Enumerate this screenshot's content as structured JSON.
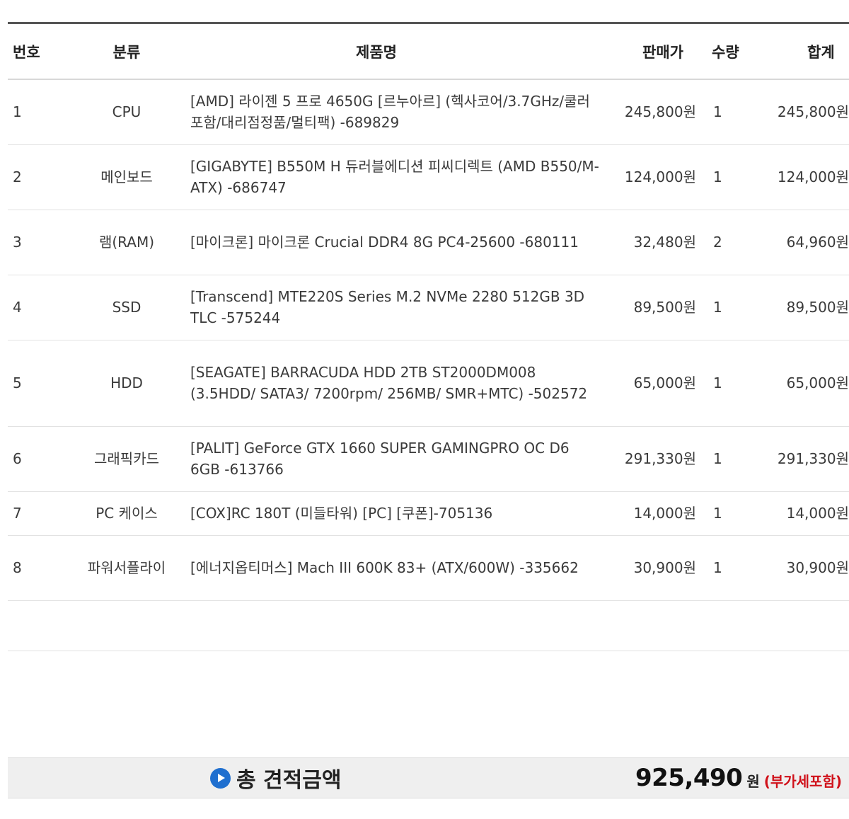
{
  "table": {
    "headers": {
      "num": "번호",
      "category": "분류",
      "product": "제품명",
      "price": "판매가",
      "qty": "수량",
      "total": "합계"
    },
    "rows": [
      {
        "num": "1",
        "category": "CPU",
        "product": "[AMD] 라이젠 5 프로 4650G [르누아르] (헥사코어/3.7GHz/쿨러포함/대리점정품/멀티팩) -689829",
        "price": "245,800원",
        "qty": "1",
        "total": "245,800원"
      },
      {
        "num": "2",
        "category": "메인보드",
        "product": "[GIGABYTE] B550M H 듀러블에디션 피씨디렉트 (AMD B550/M-ATX) -686747",
        "price": "124,000원",
        "qty": "1",
        "total": "124,000원"
      },
      {
        "num": "3",
        "category": "램(RAM)",
        "product": "[마이크론] 마이크론 Crucial DDR4 8G PC4-25600 -680111",
        "price": "32,480원",
        "qty": "2",
        "total": "64,960원"
      },
      {
        "num": "4",
        "category": "SSD",
        "product": "[Transcend] MTE220S Series M.2 NVMe 2280 512GB 3D TLC -575244",
        "price": "89,500원",
        "qty": "1",
        "total": "89,500원"
      },
      {
        "num": "5",
        "category": "HDD",
        "product": "[SEAGATE] BARRACUDA HDD 2TB ST2000DM008 (3.5HDD/ SATA3/ 7200rpm/ 256MB/ SMR+MTC) -502572",
        "price": "65,000원",
        "qty": "1",
        "total": "65,000원"
      },
      {
        "num": "6",
        "category": "그래픽카드",
        "product": "[PALIT] GeForce GTX 1660 SUPER GAMINGPRO OC D6 6GB -613766",
        "price": "291,330원",
        "qty": "1",
        "total": "291,330원"
      },
      {
        "num": "7",
        "category": "PC 케이스",
        "product": "[COX]RC 180T (미들타워) [PC] [쿠폰]-705136",
        "price": "14,000원",
        "qty": "1",
        "total": "14,000원"
      },
      {
        "num": "8",
        "category": "파워서플라이",
        "product": "[에너지옵티머스] Mach III 600K 83+ (ATX/600W) -335662",
        "price": "30,900원",
        "qty": "1",
        "total": "30,900원"
      }
    ]
  },
  "summary": {
    "label": "총 견적금액",
    "amount": "925,490",
    "unit": "원",
    "note": "(부가세포함)",
    "icon": "play-circle-icon",
    "accent_color": "#1f6fcf",
    "note_color": "#d0111a"
  }
}
